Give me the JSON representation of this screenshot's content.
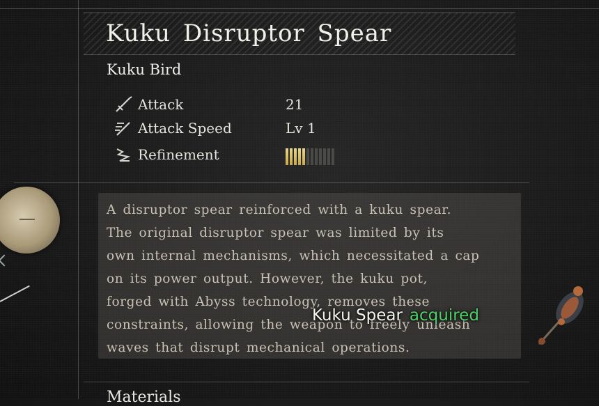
{
  "item": {
    "title": "Kuku Disruptor Spear",
    "type": "Kuku Bird"
  },
  "stats": [
    {
      "label": "Attack",
      "value": "21",
      "icon": "sword-icon"
    },
    {
      "label": "Attack Speed",
      "value": "Lv 1",
      "icon": "speed-icon"
    },
    {
      "label": "Refinement",
      "icon": "refinement-icon",
      "filled": 5,
      "total": 12
    }
  ],
  "description": [
    "A disruptor spear reinforced with a kuku spear.",
    "The original disruptor spear was limited by its",
    "own internal mechanisms, which necessitated a cap",
    "on its power output. However, the kuku pot,",
    "forged with Abyss technology, removes these",
    "constraints, allowing the weapon to freely unleash",
    "waves that disrupt mechanical operations."
  ],
  "notification": {
    "item": "Kuku Spear",
    "status": "acquired"
  },
  "materials_label": "Materials",
  "colors": {
    "refine_filled": "#d9c06a",
    "refine_empty": "#4a4a48",
    "acquired": "#4fd06a",
    "description_text": "#c9c1b3"
  }
}
